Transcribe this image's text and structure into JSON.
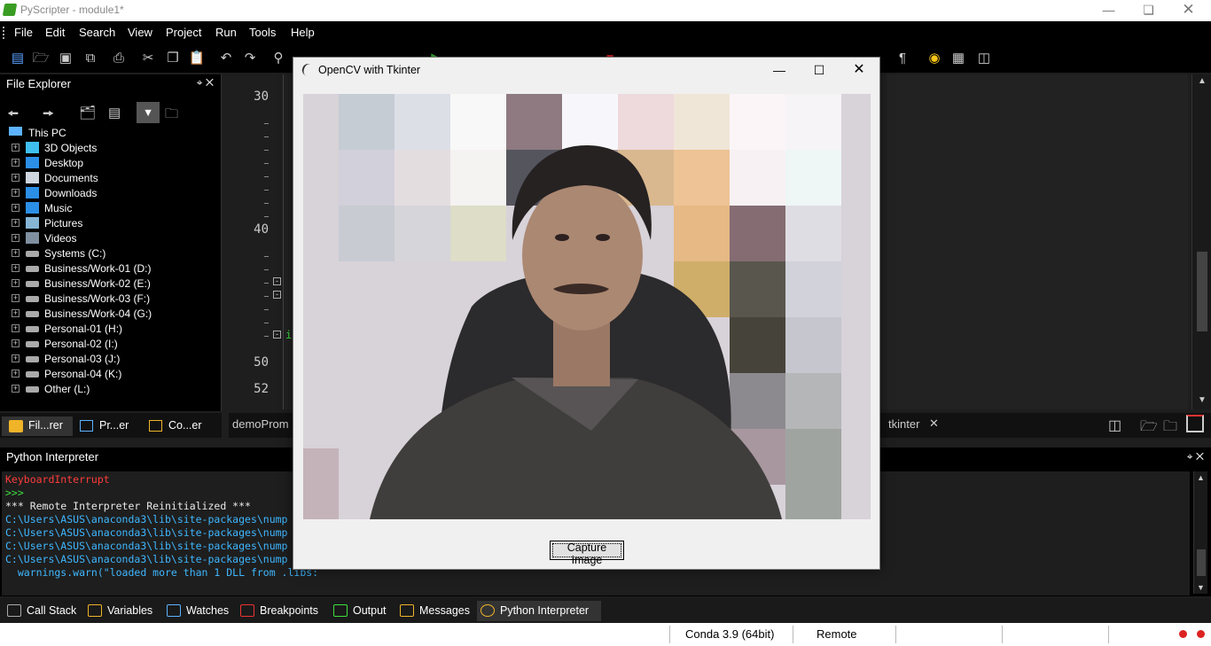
{
  "app": {
    "title": "PyScripter - module1*"
  },
  "menu": [
    "File",
    "Edit",
    "Search",
    "View",
    "Project",
    "Run",
    "Tools",
    "Help"
  ],
  "file_explorer": {
    "title": "File Explorer",
    "root": "This PC",
    "items": [
      {
        "label": "3D Objects",
        "icon": "3d-objects-icon"
      },
      {
        "label": "Desktop",
        "icon": "desktop-icon"
      },
      {
        "label": "Documents",
        "icon": "documents-icon"
      },
      {
        "label": "Downloads",
        "icon": "downloads-icon"
      },
      {
        "label": "Music",
        "icon": "music-icon"
      },
      {
        "label": "Pictures",
        "icon": "pictures-icon"
      },
      {
        "label": "Videos",
        "icon": "videos-icon"
      },
      {
        "label": "Systems (C:)",
        "icon": "drive-icon"
      },
      {
        "label": "Business/Work-01 (D:)",
        "icon": "drive-icon"
      },
      {
        "label": "Business/Work-02 (E:)",
        "icon": "drive-icon"
      },
      {
        "label": "Business/Work-03 (F:)",
        "icon": "drive-icon"
      },
      {
        "label": "Business/Work-04 (G:)",
        "icon": "drive-icon"
      },
      {
        "label": "Personal-01 (H:)",
        "icon": "drive-icon"
      },
      {
        "label": "Personal-02 (I:)",
        "icon": "drive-icon"
      },
      {
        "label": "Personal-03 (J:)",
        "icon": "drive-icon"
      },
      {
        "label": "Personal-04 (K:)",
        "icon": "drive-icon"
      },
      {
        "label": "Other (L:)",
        "icon": "drive-icon"
      }
    ]
  },
  "left_tabs": [
    "Fil...rer",
    "Pr...er",
    "Co...er"
  ],
  "editor": {
    "line_numbers": [
      "30",
      "40",
      "50",
      "52"
    ],
    "code_fragment": "i",
    "tabs": [
      "demoProm",
      "tkinter"
    ]
  },
  "interpreter": {
    "title": "Python Interpreter",
    "lines": [
      {
        "text": "KeyboardInterrupt",
        "color": "#ff3b3b"
      },
      {
        "text": ">>>",
        "color": "#3ee03e"
      },
      {
        "text": "*** Remote Interpreter Reinitialized ***",
        "color": "#e8e8e8"
      },
      {
        "text": "C:\\Users\\ASUS\\anaconda3\\lib\\site-packages\\nump",
        "color": "#3fb7ff"
      },
      {
        "text": "C:\\Users\\ASUS\\anaconda3\\lib\\site-packages\\nump",
        "color": "#3fb7ff"
      },
      {
        "text": "C:\\Users\\ASUS\\anaconda3\\lib\\site-packages\\nump",
        "color": "#3fb7ff"
      },
      {
        "text": "C:\\Users\\ASUS\\anaconda3\\lib\\site-packages\\nump",
        "color": "#3fb7ff"
      },
      {
        "text": "  warnings.warn(\"loaded more than 1 DLL from .libs:",
        "color": "#3fb7ff"
      }
    ]
  },
  "bottom_tabs": [
    "Call Stack",
    "Variables",
    "Watches",
    "Breakpoints",
    "Output",
    "Messages",
    "Python Interpreter"
  ],
  "status": {
    "env": "Conda 3.9 (64bit)",
    "mode": "Remote"
  },
  "tk_window": {
    "title": "OpenCV with Tkinter",
    "capture_label": "Capture Image"
  }
}
